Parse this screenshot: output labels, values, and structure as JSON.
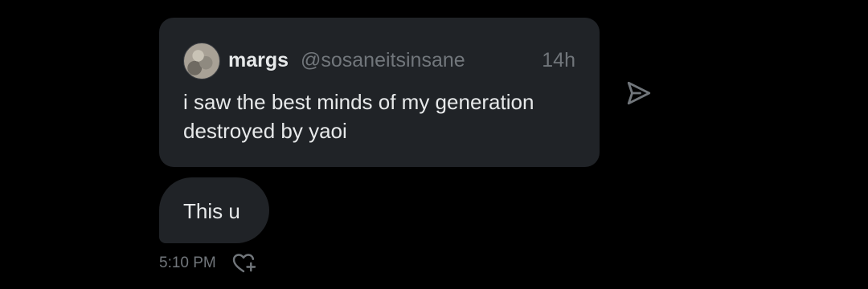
{
  "quoted_post": {
    "author_name": "margs",
    "author_handle": "@sosaneitsinsane",
    "time": "14h",
    "text": "i saw the best minds of my generation destroyed by yaoi",
    "avatar_icon": "user-avatar"
  },
  "share_icon": "send-icon",
  "message": {
    "text": "This u",
    "timestamp": "5:10 PM",
    "react_icon": "heart-plus-icon"
  },
  "colors": {
    "background": "#000000",
    "bubble": "#202327",
    "primary_text": "#e7e9ea",
    "secondary_text": "#71767b"
  }
}
